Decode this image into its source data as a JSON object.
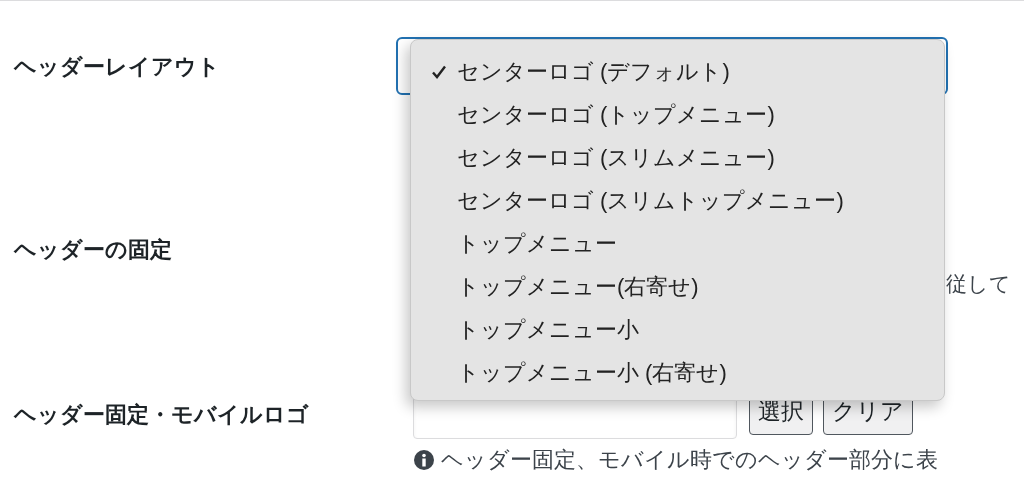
{
  "settings": [
    {
      "kind": "select",
      "label": "ヘッダーレイアウト",
      "focused": true
    },
    {
      "kind": "text",
      "label": "ヘッダーの固定",
      "description": "従して"
    },
    {
      "kind": "image",
      "label": "ヘッダー固定・モバイルロゴ",
      "buttons": [
        "選択",
        "クリア"
      ],
      "help": "ヘッダー固定、モバイル時でのヘッダー部分に表"
    }
  ],
  "dropdown_menu": {
    "items": [
      {
        "label": "センターロゴ (デフォルト)",
        "selected": true
      },
      {
        "label": "センターロゴ (トップメニュー)",
        "selected": false
      },
      {
        "label": "センターロゴ (スリムメニュー)",
        "selected": false
      },
      {
        "label": "センターロゴ (スリムトップメニュー)",
        "selected": false
      },
      {
        "label": "トップメニュー",
        "selected": false
      },
      {
        "label": "トップメニュー(右寄せ)",
        "selected": false
      },
      {
        "label": "トップメニュー小",
        "selected": false
      },
      {
        "label": "トップメニュー小 (右寄せ)",
        "selected": false
      }
    ]
  }
}
